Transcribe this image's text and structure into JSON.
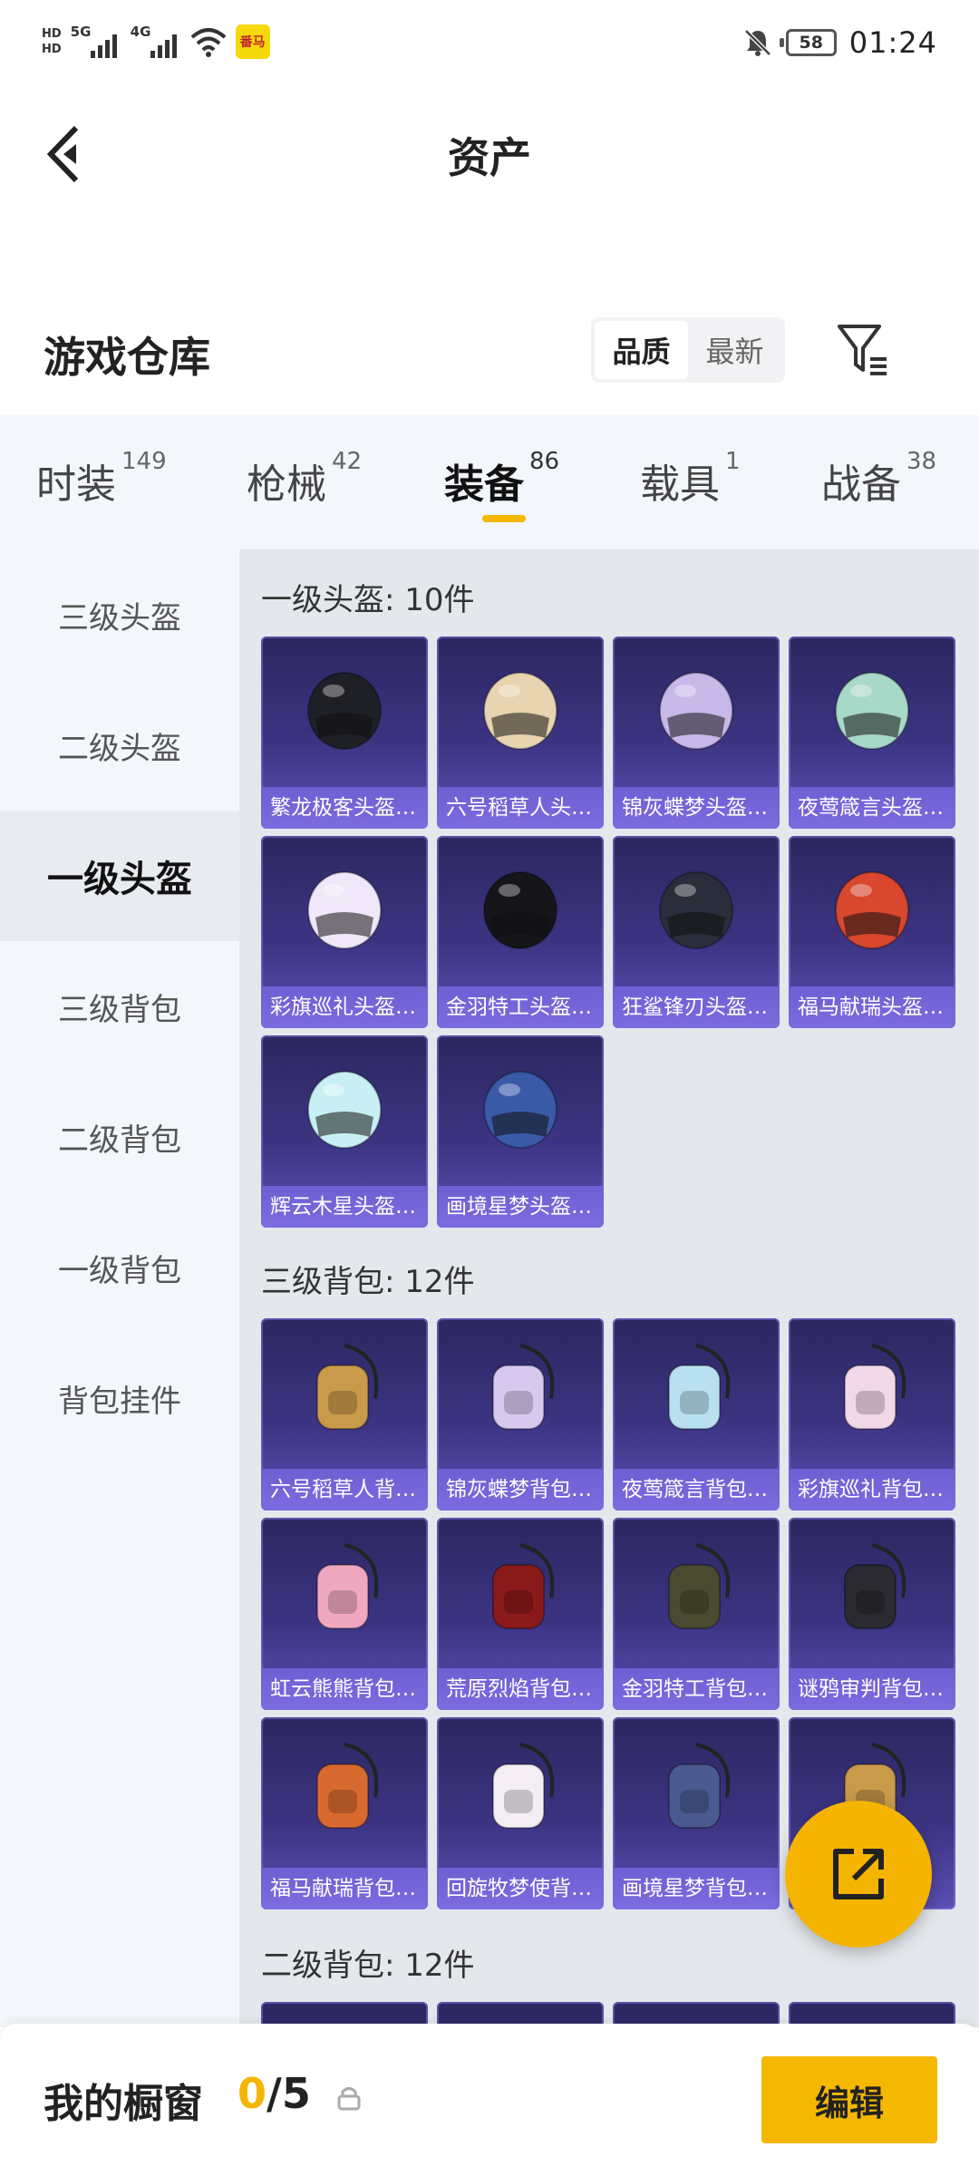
{
  "status_bar": {
    "hd1": "HD",
    "hd2": "HD",
    "net1": "5G",
    "net2": "4G",
    "app_badge": "番马",
    "battery": "58",
    "time": "01:24"
  },
  "header": {
    "title": "资产"
  },
  "warehouse": {
    "title": "游戏仓库",
    "sort_options": [
      "品质",
      "最新"
    ],
    "active_sort": "品质"
  },
  "tabs": [
    {
      "label": "时装",
      "count": "149"
    },
    {
      "label": "枪械",
      "count": "42"
    },
    {
      "label": "装备",
      "count": "86",
      "active": true
    },
    {
      "label": "载具",
      "count": "1"
    },
    {
      "label": "战备",
      "count": "38"
    }
  ],
  "sidebar": {
    "items": [
      "三级头盔",
      "二级头盔",
      "一级头盔",
      "三级背包",
      "二级背包",
      "一级背包",
      "背包挂件"
    ],
    "active": "一级头盔"
  },
  "sections": [
    {
      "title": "一级头盔: 10件",
      "items": [
        "繁龙极客头盔…",
        "六号稻草人头…",
        "锦灰蝶梦头盔…",
        "夜莺箴言头盔…",
        "彩旗巡礼头盔…",
        "金羽特工头盔…",
        "狂鲨锋刃头盔…",
        "福马献瑞头盔…",
        "辉云木星头盔…",
        "画境星梦头盔…"
      ]
    },
    {
      "title": "三级背包: 12件",
      "items": [
        "六号稻草人背…",
        "锦灰蝶梦背包…",
        "夜莺箴言背包…",
        "彩旗巡礼背包…",
        "虹云熊熊背包…",
        "荒原烈焰背包…",
        "金羽特工背包…",
        "谜鸦审判背包…",
        "福马献瑞背包…",
        "回旋牧梦使背…",
        "画境星梦背包…",
        ""
      ]
    },
    {
      "title": "二级背包: 12件",
      "items": []
    }
  ],
  "bottom_bar": {
    "title": "我的橱窗",
    "count_current": "0",
    "count_sep_total": "/5",
    "edit_label": "编辑"
  },
  "colors": {
    "accent": "#f5b800",
    "card_bg": "#3c3482",
    "card_label": "#7d6be0"
  }
}
